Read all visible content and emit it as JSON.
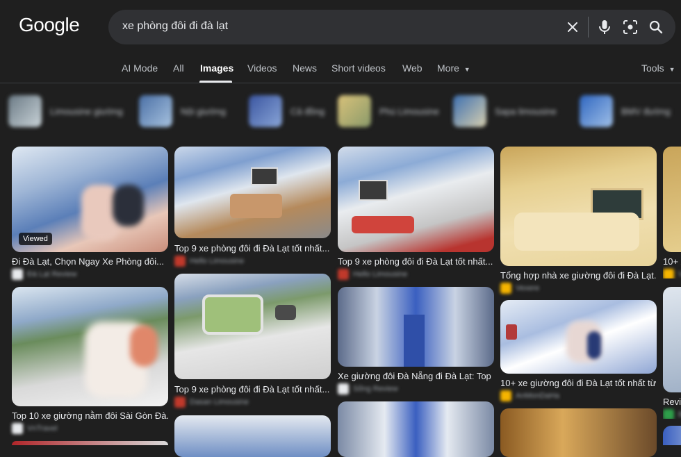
{
  "header": {
    "logo": "Google",
    "query": "xe phòng đôi đi đà lạt"
  },
  "tabs": [
    {
      "label": "AI Mode",
      "active": false
    },
    {
      "label": "All",
      "active": false
    },
    {
      "label": "Images",
      "active": true
    },
    {
      "label": "Videos",
      "active": false
    },
    {
      "label": "News",
      "active": false
    },
    {
      "label": "Short videos",
      "active": false
    },
    {
      "label": "Web",
      "active": false
    },
    {
      "label": "More",
      "active": false
    }
  ],
  "tools_label": "Tools",
  "icons": {
    "clear": "close-icon",
    "voice": "microphone-icon",
    "lens": "lens-icon",
    "search": "search-icon"
  },
  "chips": [
    {
      "label": "Limousine giường"
    },
    {
      "label": "Nội giường"
    },
    {
      "label": "Cả đồng"
    },
    {
      "label": "Phú Limousine"
    },
    {
      "label": "Sapa limousine"
    },
    {
      "label": "BMV đường"
    }
  ],
  "results": [
    {
      "caption": "Đi Đà Lạt, Chọn Ngay Xe Phòng đôi...",
      "source": "Đà Lạt Review",
      "badge": "Viewed"
    },
    {
      "caption": "Top 9 xe phòng đôi đi Đà Lạt tốt nhất...",
      "source": "Hello Limousine"
    },
    {
      "caption": "Top 9 xe phòng đôi đi Đà Lạt tốt nhất...",
      "source": "Hello Limousine"
    },
    {
      "caption": "Tổng hợp nhà xe giường đôi đi Đà Lạt...",
      "source": "Vexere"
    },
    {
      "caption": "10+ x",
      "source": "V"
    },
    {
      "caption": "Top 10 xe giường nằm đôi Sài Gòn Đà...",
      "source": "VnTravel"
    },
    {
      "caption": "Top 9 xe phòng đôi đi Đà Lạt tốt nhất...",
      "source": "Dasan Limousine"
    },
    {
      "caption": "Xe giường đôi Đà Nẵng đi Đà Lạt: Top 2...",
      "source": "Sống Review"
    },
    {
      "caption": "10+ xe giường đôi đi Đà Lạt tốt nhất từ...",
      "source": "AnMonDaHa"
    },
    {
      "caption": "Revie",
      "source": "B"
    }
  ]
}
